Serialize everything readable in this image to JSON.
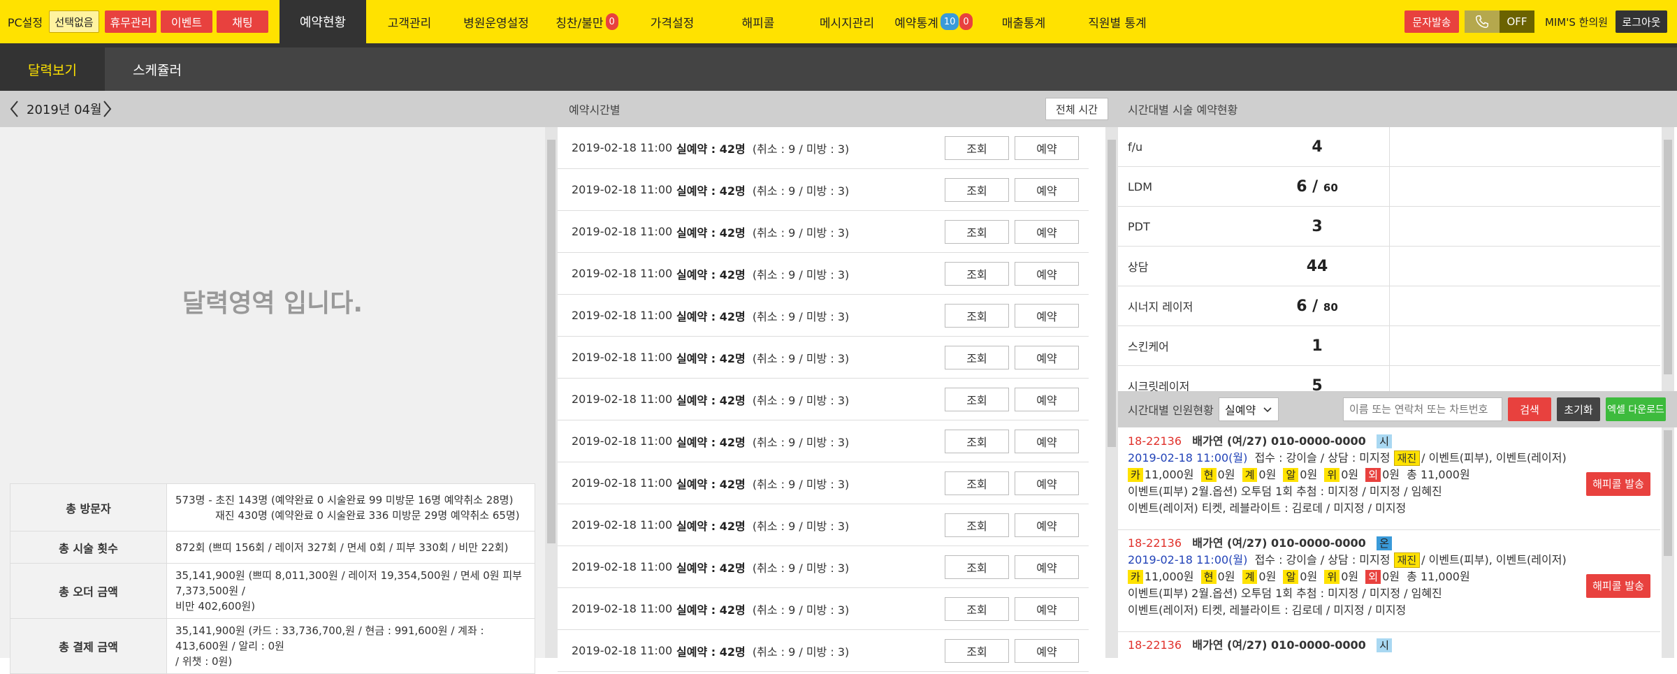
{
  "topbar": {
    "pc_setting": "PC설정",
    "no_selection": "선택없음",
    "holiday": "휴무관리",
    "event": "이벤트",
    "chat": "채팅",
    "nav": [
      "예약현황",
      "고객관리",
      "병원운영설정",
      "칭찬/불만",
      "가격설정",
      "해피콜",
      "메시지관리",
      "예약통계",
      "매출통계",
      "직원별 통계"
    ],
    "praise_badge": "0",
    "stats_badge_blue": "10",
    "stats_badge_red": "0",
    "sms": "문자발송",
    "phone_status": "OFF",
    "clinic": "MIM'S 한의원",
    "logout": "로그아웃"
  },
  "subnav": {
    "calendar_view": "달력보기",
    "scheduler": "스케쥴러"
  },
  "calendar": {
    "month": "2019년 04월",
    "placeholder": "달력영역 입니다."
  },
  "stats": [
    {
      "label": "총 방문자",
      "lines": [
        "573명 -   초진 143명 (예약완료 0 시술완료 99 미방문 16명 예약취소 28명)",
        "재진 430명 (예약완료 0 시술완료 336 미방문 29명 예약취소 65명)"
      ]
    },
    {
      "label": "총 시술 횟수",
      "lines": [
        "872회 (쁘띠 156회 / 레이저 327회 / 면세 0회 / 피부 330회 / 비만 22회)"
      ]
    },
    {
      "label": "총 오더 금액",
      "lines": [
        "35,141,900원 (쁘띠 8,011,300원 / 레이저 19,354,500원 / 면세 0원 피부 7,373,500원 /",
        "비만 402,600원)"
      ]
    },
    {
      "label": "총 결제 금액",
      "lines": [
        "35,141,900원 (카드 : 33,736,700,원 / 현금 : 991,600원 / 계좌 : 413,600원 / 알리 : 0원",
        "/ 위챗 : 0원)"
      ]
    }
  ],
  "reservation": {
    "header": "예약시간별",
    "all_time": "전체 시간",
    "view_label": "조회",
    "reserve_label": "예약",
    "rows": [
      {
        "date": "2019-02-18 11:00",
        "count": "실예약 : 42명",
        "detail": "(취소 : 9 / 미방 : 3)"
      },
      {
        "date": "2019-02-18 11:00",
        "count": "실예약 : 42명",
        "detail": "(취소 : 9 / 미방 : 3)"
      },
      {
        "date": "2019-02-18 11:00",
        "count": "실예약 : 42명",
        "detail": "(취소 : 9 / 미방 : 3)"
      },
      {
        "date": "2019-02-18 11:00",
        "count": "실예약 : 42명",
        "detail": "(취소 : 9 / 미방 : 3)"
      },
      {
        "date": "2019-02-18 11:00",
        "count": "실예약 : 42명",
        "detail": "(취소 : 9 / 미방 : 3)"
      },
      {
        "date": "2019-02-18 11:00",
        "count": "실예약 : 42명",
        "detail": "(취소 : 9 / 미방 : 3)"
      },
      {
        "date": "2019-02-18 11:00",
        "count": "실예약 : 42명",
        "detail": "(취소 : 9 / 미방 : 3)"
      },
      {
        "date": "2019-02-18 11:00",
        "count": "실예약 : 42명",
        "detail": "(취소 : 9 / 미방 : 3)"
      },
      {
        "date": "2019-02-18 11:00",
        "count": "실예약 : 42명",
        "detail": "(취소 : 9 / 미방 : 3)"
      },
      {
        "date": "2019-02-18 11:00",
        "count": "실예약 : 42명",
        "detail": "(취소 : 9 / 미방 : 3)"
      },
      {
        "date": "2019-02-18 11:00",
        "count": "실예약 : 42명",
        "detail": "(취소 : 9 / 미방 : 3)"
      },
      {
        "date": "2019-02-18 11:00",
        "count": "실예약 : 42명",
        "detail": "(취소 : 9 / 미방 : 3)"
      },
      {
        "date": "2019-02-18 11:00",
        "count": "실예약 : 42명",
        "detail": "(취소 : 9 / 미방 : 3)"
      }
    ]
  },
  "treatments": {
    "header": "시간대별 시술 예약현황",
    "rows": [
      {
        "name": "f/u",
        "count": "4",
        "cap": ""
      },
      {
        "name": "LDM",
        "count": "6 /",
        "cap": "60"
      },
      {
        "name": "PDT",
        "count": "3",
        "cap": ""
      },
      {
        "name": "상담",
        "count": "44",
        "cap": ""
      },
      {
        "name": "시너지 레이저",
        "count": "6 /",
        "cap": "80"
      },
      {
        "name": "스킨케어",
        "count": "1",
        "cap": ""
      },
      {
        "name": "시크릿레이저",
        "count": "5",
        "cap": ""
      }
    ]
  },
  "patients": {
    "header": "시간대별 인원현황",
    "filter": "실예약",
    "search_placeholder": "이름 또는 연락처 또는 차트번호",
    "search": "검색",
    "reset": "초기화",
    "excel": "엑셀 다운로드",
    "send": "해피콜 발송",
    "cards": [
      {
        "chart": "18-22136",
        "name": "배가연 (여/27) 010-0000-0000",
        "badge": "시",
        "date": "2019-02-18 11:00(월)",
        "reception": "접수 : 강이슬 / 상담 : 미지정",
        "visit": "재진",
        "after": "/ 이벤트(피부), 이벤트(레이저)",
        "pay": [
          [
            "카",
            "11,000원"
          ],
          [
            "현",
            "0원"
          ],
          [
            "계",
            "0원"
          ],
          [
            "알",
            "0원"
          ],
          [
            "위",
            "0원"
          ],
          [
            "외",
            "0원"
          ]
        ],
        "total": "총 11,000원",
        "l3": "이벤트(피부) 2월.옵션) 오투덤 1회 추첨 : 미지정 / 미지정 / 임혜진",
        "l4": "이벤트(레이저) 티켓, 레블라이트 : 김로데 / 미지정 / 미지정"
      },
      {
        "chart": "18-22136",
        "name": "배가연 (여/27) 010-0000-0000",
        "badge": "온",
        "date": "2019-02-18 11:00(월)",
        "reception": "접수 : 강이슬 / 상담 : 미지정",
        "visit": "재진",
        "after": "/ 이벤트(피부), 이벤트(레이저)",
        "pay": [
          [
            "카",
            "11,000원"
          ],
          [
            "현",
            "0원"
          ],
          [
            "계",
            "0원"
          ],
          [
            "알",
            "0원"
          ],
          [
            "위",
            "0원"
          ],
          [
            "외",
            "0원"
          ]
        ],
        "total": "총 11,000원",
        "l3": "이벤트(피부) 2월.옵션) 오투덤 1회 추첨 : 미지정 / 미지정 / 임혜진",
        "l4": "이벤트(레이저) 티켓, 레블라이트 : 김로데 / 미지정 / 미지정"
      },
      {
        "chart": "18-22136",
        "name": "배가연 (여/27) 010-0000-0000",
        "badge": "시"
      }
    ]
  },
  "colors": {
    "brand_yellow": "#ffe200",
    "accent_red": "#e8413e",
    "dark": "#444444"
  }
}
